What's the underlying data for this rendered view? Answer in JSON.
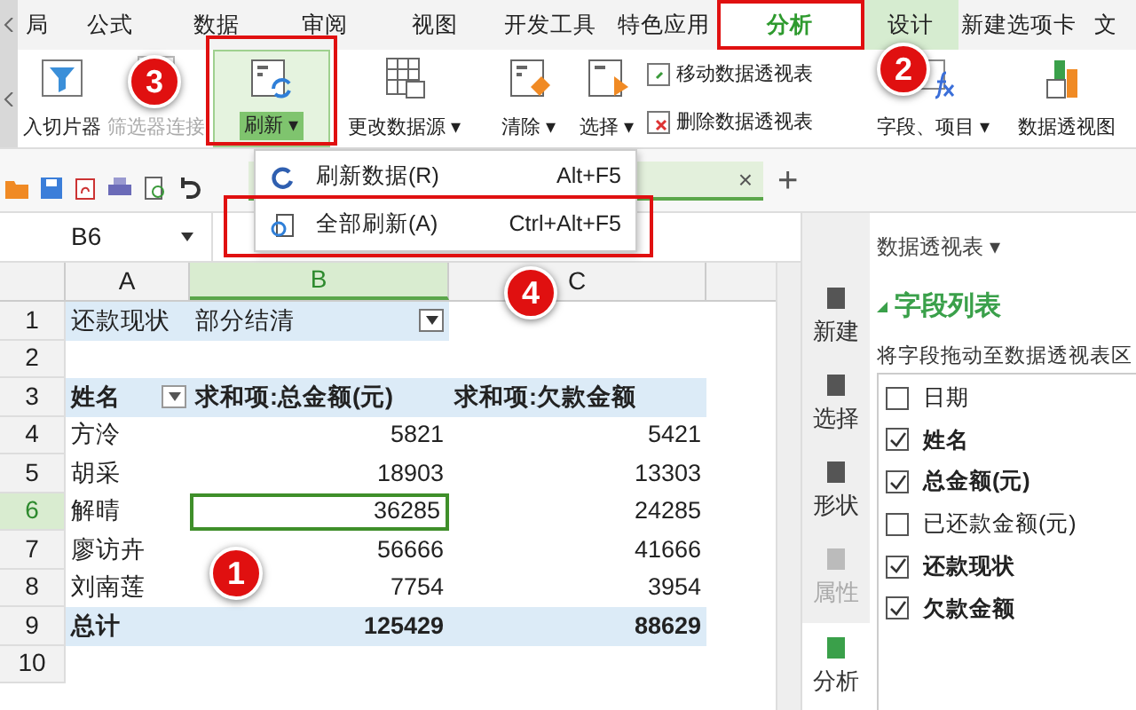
{
  "menu_tabs": [
    {
      "label": "局",
      "selected": false
    },
    {
      "label": "公式",
      "selected": false
    },
    {
      "label": "数据",
      "selected": false
    },
    {
      "label": "审阅",
      "selected": false
    },
    {
      "label": "视图",
      "selected": false
    },
    {
      "label": "开发工具",
      "selected": false
    },
    {
      "label": "特色应用",
      "selected": false
    },
    {
      "label": "分析",
      "selected": true
    },
    {
      "label": "设计",
      "selected": false
    },
    {
      "label": "新建选项卡",
      "selected": false
    },
    {
      "label": "文",
      "selected": false
    }
  ],
  "ribbon": [
    {
      "kind": "big",
      "label": "入切片器",
      "disabled": false,
      "active": false
    },
    {
      "kind": "big",
      "label": "筛选器连接",
      "disabled": true,
      "active": false
    },
    {
      "kind": "big",
      "label": "刷新 ▾",
      "disabled": false,
      "active": true
    },
    {
      "kind": "big",
      "label": "更改数据源 ▾",
      "disabled": false,
      "active": false
    },
    {
      "kind": "big",
      "label": "清除 ▾",
      "disabled": false,
      "active": false
    },
    {
      "kind": "big",
      "label": "选择 ▾",
      "disabled": false,
      "active": false
    },
    {
      "kind": "small",
      "items": [
        "移动数据透视表",
        "删除数据透视表"
      ]
    },
    {
      "kind": "big",
      "label": "字段、项目 ▾",
      "disabled": false,
      "active": false
    },
    {
      "kind": "big",
      "label": "数据透视图",
      "disabled": false,
      "active": false
    }
  ],
  "dropdown": [
    {
      "label": "刷新数据(R)",
      "shortcut": "Alt+F5"
    },
    {
      "label": "全部刷新(A)",
      "shortcut": "Ctrl+Alt+F5"
    }
  ],
  "document_tab": {
    "close": "×",
    "new": "+"
  },
  "name_box": "B6",
  "columns": [
    {
      "label": "A",
      "selected": false
    },
    {
      "label": "B",
      "selected": true
    },
    {
      "label": "C",
      "selected": false
    }
  ],
  "rows": [
    {
      "n": "1",
      "kind": "filter",
      "cells": [
        "还款现状",
        "部分结清",
        ""
      ],
      "selected": false
    },
    {
      "n": "2",
      "kind": "blank",
      "cells": [
        "",
        "",
        ""
      ],
      "selected": false
    },
    {
      "n": "3",
      "kind": "header",
      "cells": [
        "姓名",
        "求和项:总金额(元)",
        "求和项:欠款金额"
      ],
      "selected": false
    },
    {
      "n": "4",
      "kind": "data",
      "cells": [
        "方泠",
        "5821",
        "5421"
      ],
      "selected": false
    },
    {
      "n": "5",
      "kind": "data",
      "cells": [
        "胡采",
        "18903",
        "13303"
      ],
      "selected": false
    },
    {
      "n": "6",
      "kind": "data",
      "cells": [
        "解晴",
        "36285",
        "24285"
      ],
      "selected": true
    },
    {
      "n": "7",
      "kind": "data",
      "cells": [
        "廖访卉",
        "56666",
        "41666"
      ],
      "selected": false
    },
    {
      "n": "8",
      "kind": "data",
      "cells": [
        "刘南莲",
        "7754",
        "3954"
      ],
      "selected": false
    },
    {
      "n": "9",
      "kind": "total",
      "cells": [
        "总计",
        "125429",
        "88629"
      ],
      "selected": false
    },
    {
      "n": "10",
      "kind": "blank",
      "cells": [
        "",
        "",
        ""
      ],
      "selected": false
    }
  ],
  "side_tools": [
    {
      "label": "新建",
      "disabled": false,
      "selected": false
    },
    {
      "label": "选择",
      "disabled": false,
      "selected": false
    },
    {
      "label": "形状",
      "disabled": false,
      "selected": false
    },
    {
      "label": "属性",
      "disabled": true,
      "selected": false
    },
    {
      "label": "分析",
      "disabled": false,
      "selected": true
    }
  ],
  "task_pane": {
    "title": "数据透视表 ▾",
    "section": "字段列表",
    "hint": "将字段拖动至数据透视表区",
    "fields": [
      {
        "label": "日期",
        "checked": false
      },
      {
        "label": "姓名",
        "checked": true
      },
      {
        "label": "总金额(元)",
        "checked": true
      },
      {
        "label": "已还款金额(元)",
        "checked": false
      },
      {
        "label": "还款现状",
        "checked": true
      },
      {
        "label": "欠款金额",
        "checked": true
      }
    ]
  },
  "step_badges": [
    "1",
    "2",
    "3",
    "4"
  ]
}
